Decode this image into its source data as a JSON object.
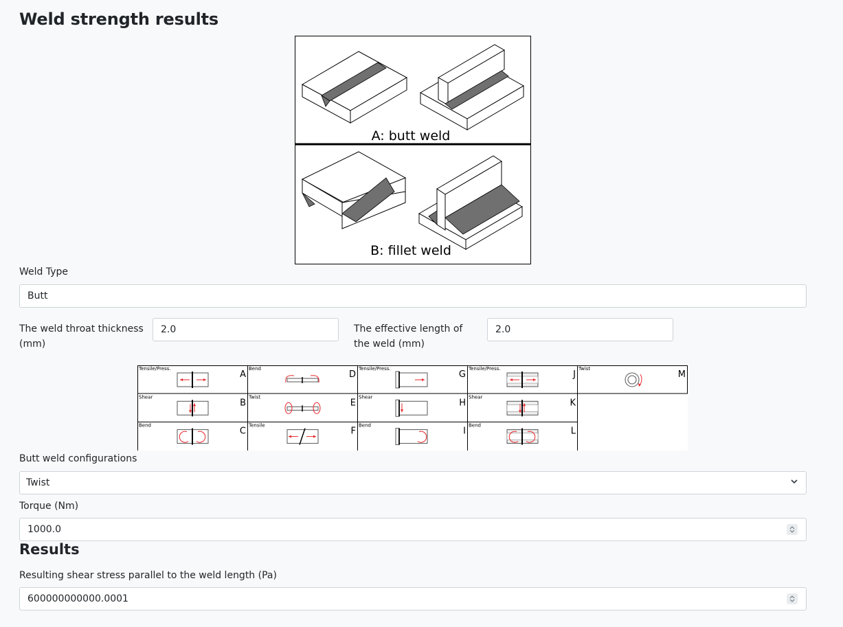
{
  "page_title": "Weld strength results",
  "weld_figure": {
    "label_a": "A: butt weld",
    "label_b": "B: fillet weld"
  },
  "weld_type": {
    "label": "Weld Type",
    "value": "Butt"
  },
  "throat": {
    "label_line1": "The weld throat thickness",
    "label_line2": "(mm)",
    "value": "2.0"
  },
  "length": {
    "label_line1": "The effective length of",
    "label_line2": "the weld (mm)",
    "value": "2.0"
  },
  "config_figure": {
    "cells": [
      {
        "title": "Tensile/Press.",
        "letter": "A"
      },
      {
        "title": "Bend",
        "letter": "D"
      },
      {
        "title": "Tensile/Press.",
        "letter": "G"
      },
      {
        "title": "Tensile/Press.",
        "letter": "J"
      },
      {
        "title": "Twist",
        "letter": "M"
      },
      {
        "title": "Shear",
        "letter": "B"
      },
      {
        "title": "Twist",
        "letter": "E"
      },
      {
        "title": "Shear",
        "letter": "H"
      },
      {
        "title": "Shear",
        "letter": "K"
      },
      {
        "title": "Bend",
        "letter": "C"
      },
      {
        "title": "Tensile",
        "letter": "F"
      },
      {
        "title": "Bend",
        "letter": "I"
      },
      {
        "title": "Bend",
        "letter": "L"
      }
    ]
  },
  "config_select": {
    "label": "Butt weld configurations",
    "value": "Twist"
  },
  "torque": {
    "label": "Torque (Nm)",
    "value": "1000.0"
  },
  "results": {
    "heading": "Results",
    "label": "Resulting shear stress parallel to the weld length (Pa)",
    "value": "600000000000.0001"
  },
  "colors": {
    "arrow": "#e8262b",
    "weld_fill": "#6e6e6e",
    "border": "#ced4da"
  }
}
